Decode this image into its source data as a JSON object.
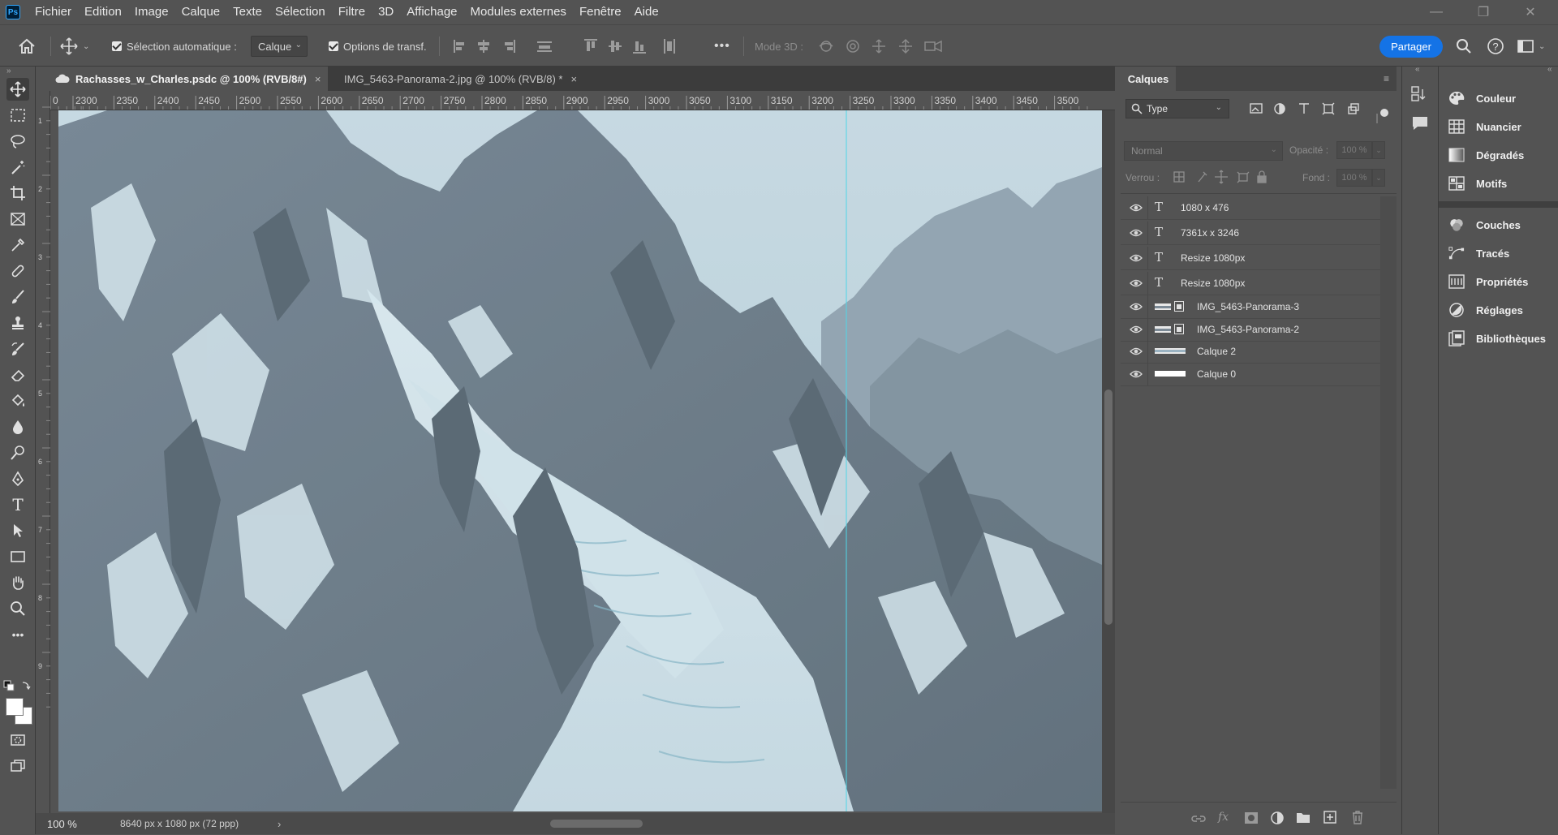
{
  "app": {
    "logo": "Ps"
  },
  "menu": [
    "Fichier",
    "Edition",
    "Image",
    "Calque",
    "Texte",
    "Sélection",
    "Filtre",
    "3D",
    "Affichage",
    "Modules externes",
    "Fenêtre",
    "Aide"
  ],
  "window_controls": {
    "minimize": "—",
    "restore": "❐",
    "close": "✕"
  },
  "options": {
    "auto_select_label": "Sélection automatique :",
    "auto_select_target": "Calque",
    "transform_label": "Options de transf.",
    "more": "•••",
    "mode3d_label": "Mode 3D :",
    "share_label": "Partager"
  },
  "tabs": [
    {
      "label": "Rachasses_w_Charles.psdc @ 100% (RVB/8#)",
      "active": true,
      "close": "×"
    },
    {
      "label": "IMG_5463-Panorama-2.jpg @ 100% (RVB/8) *",
      "active": false,
      "close": "×"
    }
  ],
  "ruler_h": [
    "0",
    "2300",
    "2350",
    "2400",
    "2450",
    "2500",
    "2550",
    "2600",
    "2650",
    "2700",
    "2750",
    "2800",
    "2850",
    "2900",
    "2950",
    "3000",
    "3050",
    "3100",
    "3150",
    "3200",
    "3250",
    "3300",
    "3350",
    "3400",
    "3450",
    "3500"
  ],
  "ruler_v": [
    "1",
    "2",
    "3",
    "4",
    "5",
    "6",
    "7",
    "8",
    "9"
  ],
  "status": {
    "zoom": "100 %",
    "doc_info": "8640 px x 1080 px (72 ppp)",
    "arrow": "›"
  },
  "layers_panel": {
    "title": "Calques",
    "filter_label": "Type",
    "blend_mode": "Normal",
    "opacity_label": "Opacité :",
    "opacity_value": "100 %",
    "lock_label": "Verrou :",
    "fill_label": "Fond :",
    "fill_value": "100 %",
    "layers": [
      {
        "name": "1080 x 476",
        "kind": "text",
        "type_glyph": "T"
      },
      {
        "name": "7361x x 3246",
        "kind": "text",
        "type_glyph": "T"
      },
      {
        "name": "Resize 1080px",
        "kind": "text",
        "type_glyph": "T"
      },
      {
        "name": "Resize 1080px",
        "kind": "text",
        "type_glyph": "T"
      },
      {
        "name": "IMG_5463-Panorama-3",
        "kind": "smart"
      },
      {
        "name": "IMG_5463-Panorama-2",
        "kind": "smart"
      },
      {
        "name": "Calque 2",
        "kind": "pixel"
      },
      {
        "name": "Calque 0",
        "kind": "pixel"
      }
    ],
    "footer_icons": [
      "link-icon",
      "fx-icon",
      "mask-icon",
      "adjustment-icon",
      "folder-icon",
      "new-layer-icon",
      "trash-icon"
    ],
    "fx_label": "fx"
  },
  "right_panels": [
    {
      "label": "Couleur",
      "icon": "palette-icon"
    },
    {
      "label": "Nuancier",
      "icon": "swatches-icon"
    },
    {
      "label": "Dégradés",
      "icon": "gradient-icon"
    },
    {
      "label": "Motifs",
      "icon": "patterns-icon"
    },
    {
      "label": "Couches",
      "icon": "channels-icon"
    },
    {
      "label": "Tracés",
      "icon": "paths-icon"
    },
    {
      "label": "Propriétés",
      "icon": "properties-icon"
    },
    {
      "label": "Réglages",
      "icon": "adjustments-icon"
    },
    {
      "label": "Bibliothèques",
      "icon": "libraries-icon"
    }
  ],
  "colors": {
    "accent": "#1473e6",
    "guide": "#4fd6e8",
    "canvas_base": "#b9cfd9"
  }
}
